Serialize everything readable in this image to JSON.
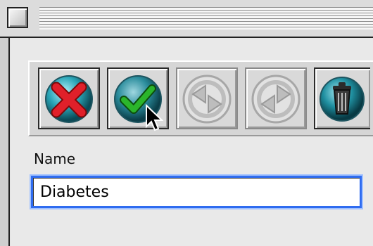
{
  "toolbar": {
    "buttons": [
      {
        "icon": "red-x-icon",
        "enabled": true
      },
      {
        "icon": "green-check-icon",
        "enabled": true
      },
      {
        "icon": "revert-left-icon",
        "enabled": false
      },
      {
        "icon": "revert-right-icon",
        "enabled": false
      },
      {
        "icon": "trash-icon",
        "enabled": true
      }
    ]
  },
  "form": {
    "name_label": "Name",
    "name_value": "Diabetes"
  },
  "colors": {
    "accent_focus": "#2f6cf0",
    "teal_orb": "#2aa6b8",
    "cancel_red": "#e0202a",
    "confirm_green": "#2bb52b"
  }
}
